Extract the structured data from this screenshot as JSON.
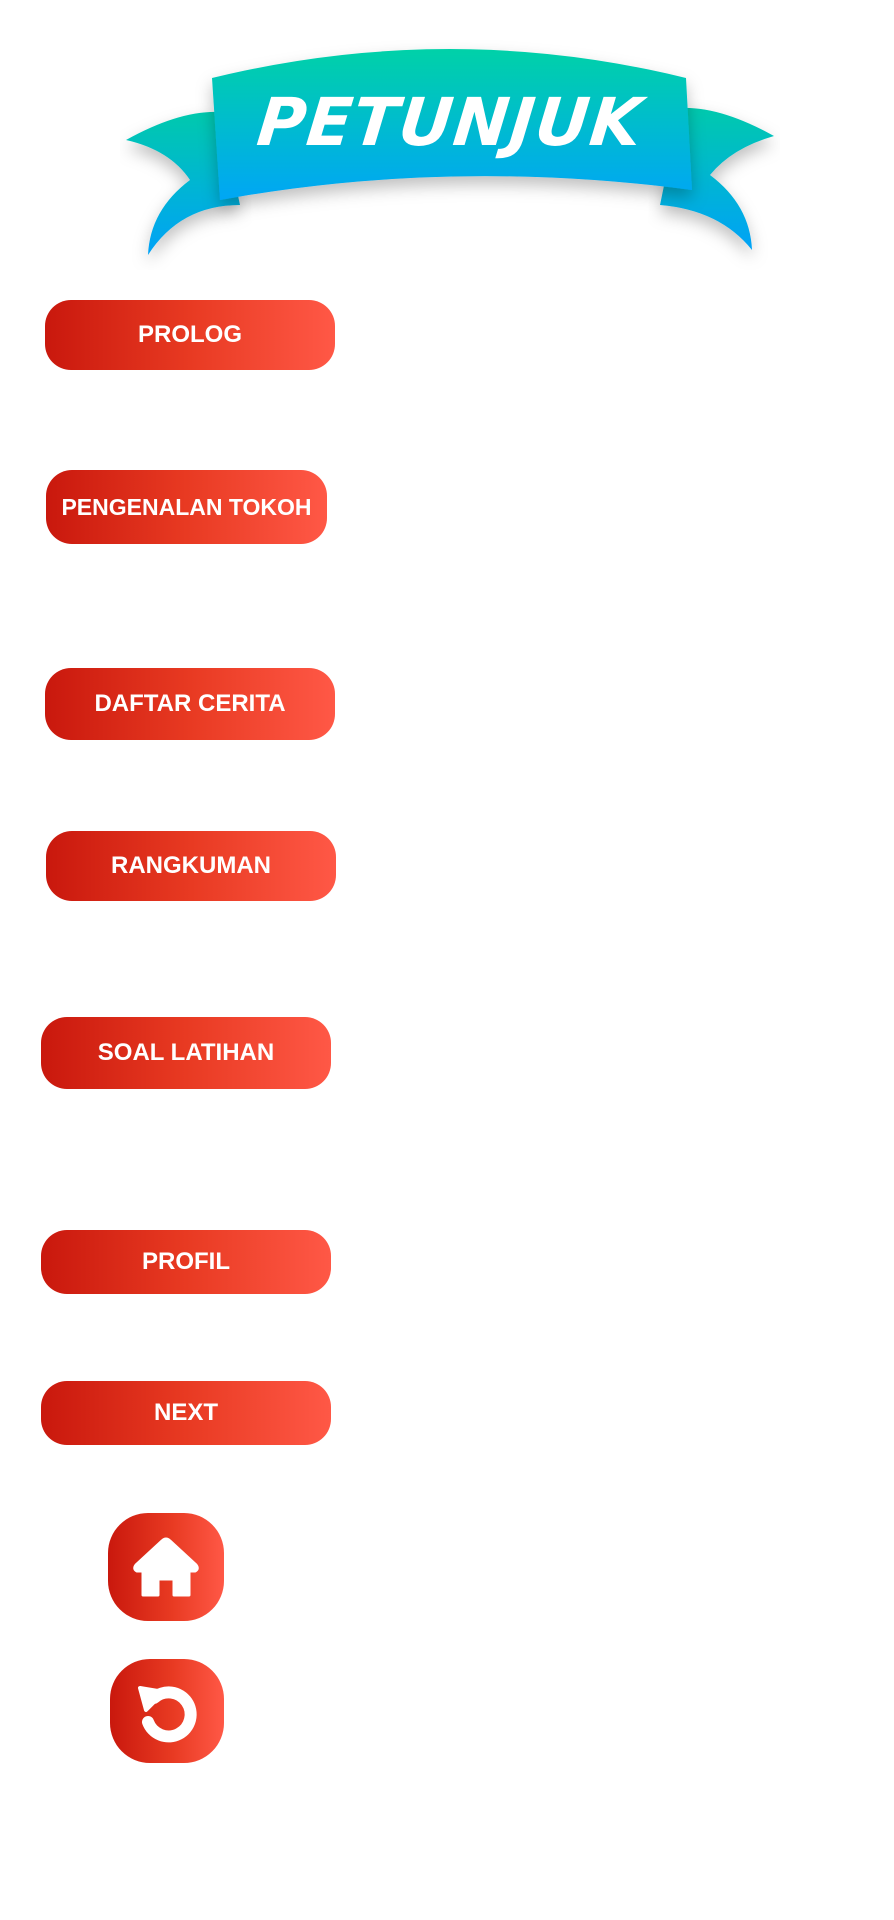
{
  "banner": {
    "title": "PETUNJUK"
  },
  "menu": {
    "prolog": "PROLOG",
    "pengenalan_tokoh": "PENGENALAN TOKOH",
    "daftar_cerita": "DAFTAR CERITA",
    "rangkuman": "RANGKUMAN",
    "soal_latihan": "SOAL LATIHAN",
    "profil": "PROFIL",
    "next": "NEXT"
  },
  "icons": {
    "home": "home-icon",
    "back": "back-arrow-icon"
  },
  "colors": {
    "button_start": "#c9180d",
    "button_end": "#ff5846",
    "banner_top": "#00d1a8",
    "banner_bottom": "#00a6f5",
    "text": "#ffffff"
  }
}
